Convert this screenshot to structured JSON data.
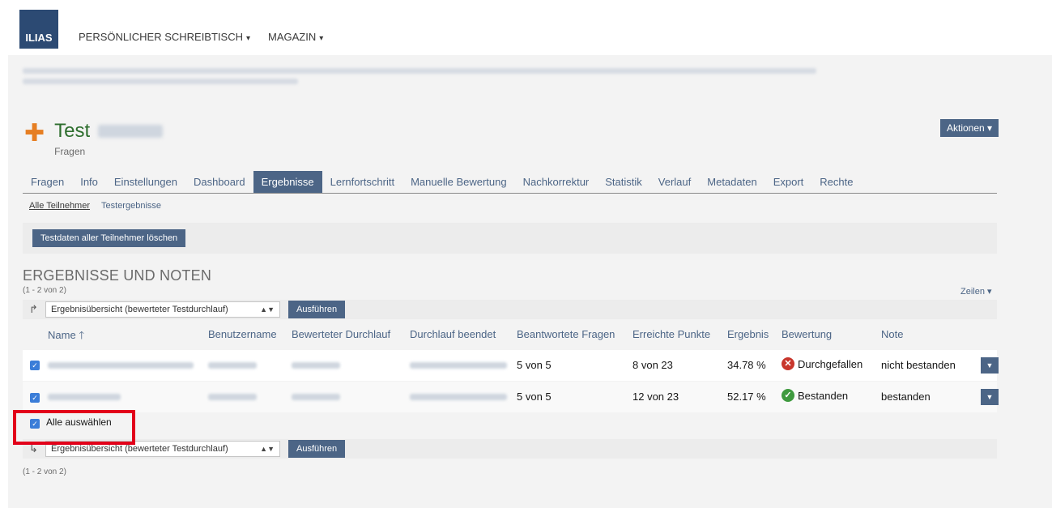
{
  "topbar": {
    "logo": "ILIAS",
    "menu": [
      {
        "label": "PERSÖNLICHER SCHREIBTISCH"
      },
      {
        "label": "MAGAZIN"
      }
    ]
  },
  "header": {
    "title": "Test",
    "subtitle": "Fragen",
    "actions_label": "Aktionen"
  },
  "tabs": [
    {
      "label": "Fragen"
    },
    {
      "label": "Info"
    },
    {
      "label": "Einstellungen"
    },
    {
      "label": "Dashboard"
    },
    {
      "label": "Ergebnisse",
      "active": true
    },
    {
      "label": "Lernfortschritt"
    },
    {
      "label": "Manuelle Bewertung"
    },
    {
      "label": "Nachkorrektur"
    },
    {
      "label": "Statistik"
    },
    {
      "label": "Verlauf"
    },
    {
      "label": "Metadaten"
    },
    {
      "label": "Export"
    },
    {
      "label": "Rechte"
    }
  ],
  "subtabs": {
    "all_participants": "Alle Teilnehmer",
    "test_results": "Testergebnisse"
  },
  "toolbar": {
    "delete_button": "Testdaten aller Teilnehmer löschen"
  },
  "results": {
    "title": "ERGEBNISSE UND NOTEN",
    "count": "(1 - 2 von 2)",
    "rows_label": "Zeilen",
    "command_select": "Ergebnisübersicht (bewerteter Testdurchlauf)",
    "execute_label": "Ausführen",
    "select_all_label": "Alle auswählen",
    "columns": {
      "name": "Name",
      "username": "Benutzername",
      "graded_run": "Bewerteter Durchlauf",
      "run_finished": "Durchlauf beendet",
      "answered": "Beantwortete Fragen",
      "points": "Erreichte Punkte",
      "result": "Ergebnis",
      "rating": "Bewertung",
      "mark": "Note"
    },
    "rows": [
      {
        "answered": "5 von 5",
        "points": "8 von 23",
        "result": "34.78 %",
        "rating": "Durchgefallen",
        "mark": "nicht bestanden",
        "passed": false
      },
      {
        "answered": "5 von 5",
        "points": "12 von 23",
        "result": "52.17 %",
        "rating": "Bestanden",
        "mark": "bestanden",
        "passed": true
      }
    ]
  },
  "colors": {
    "accent": "#4c6586",
    "title_green": "#2e6e2e",
    "fail_red": "#c8362c",
    "pass_green": "#3f9a3f",
    "highlight_red": "#e2001a"
  }
}
